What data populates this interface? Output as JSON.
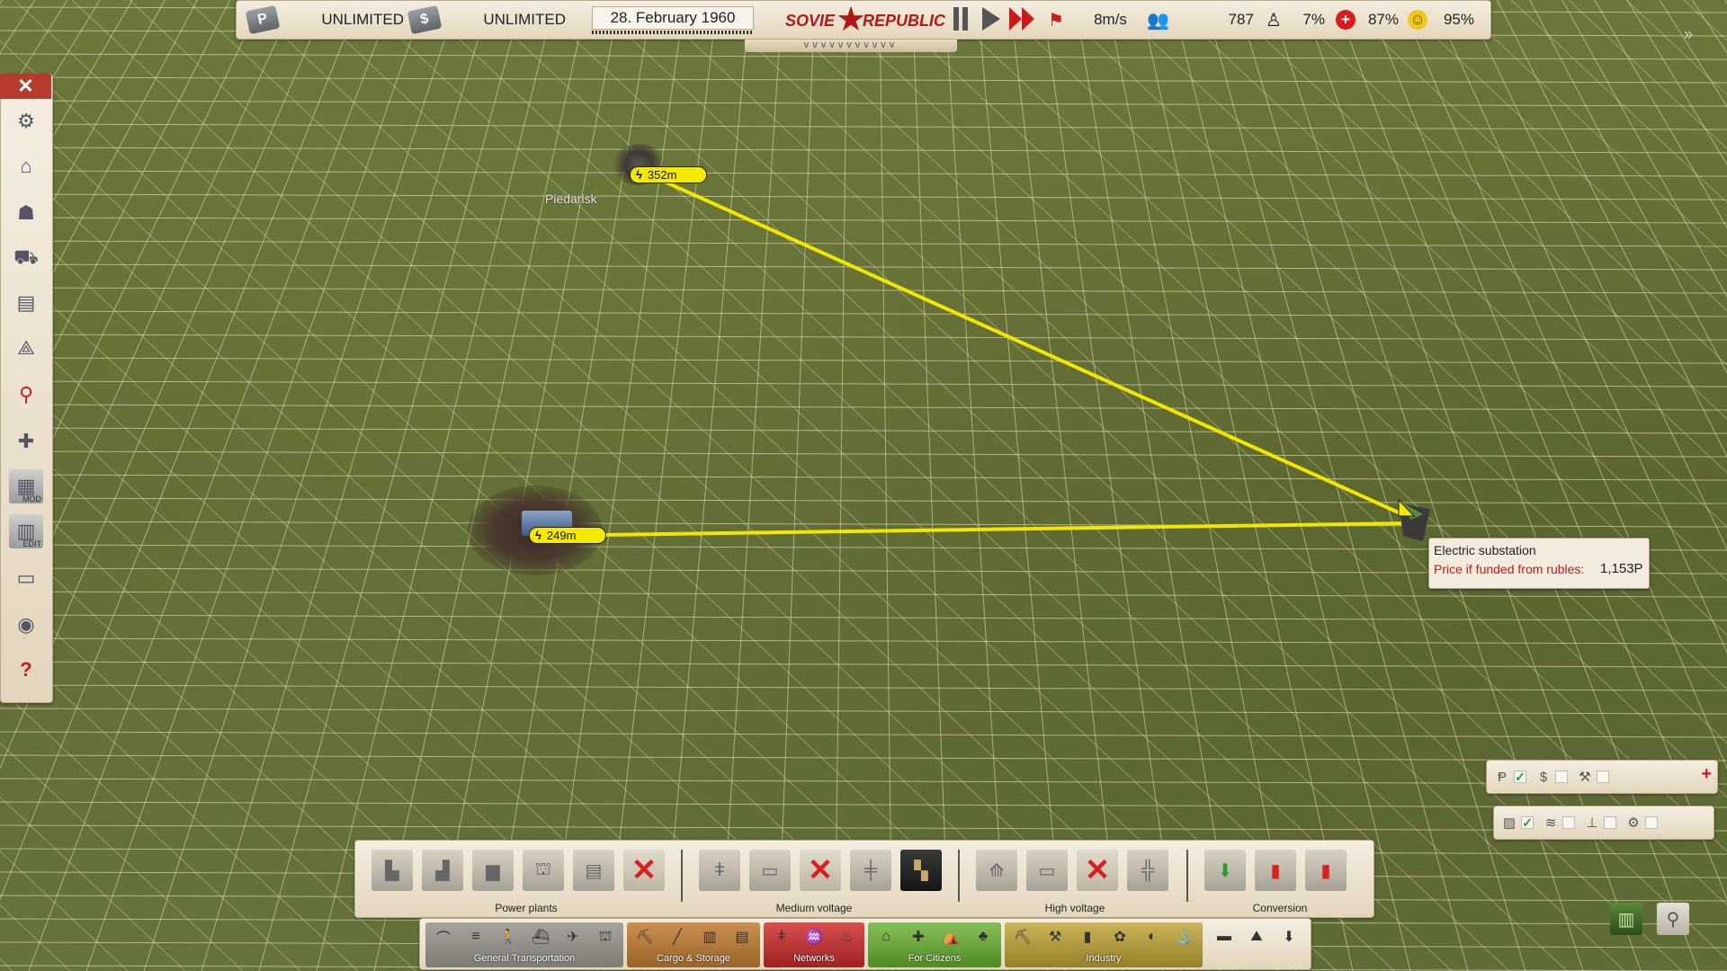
{
  "topbar": {
    "rubles_icon": "P",
    "rubles_value": "UNLIMITED",
    "dollars_icon": "$",
    "dollars_value": "UNLIMITED",
    "date": "28. February 1960",
    "logo_left": "SOVIE",
    "logo_right": "REPUBLIC",
    "wind_speed": "8m/s",
    "population": "787",
    "unemployment": "7%",
    "health": "87%",
    "happiness": "95%",
    "chevrons": "vvvvvvvvvvv"
  },
  "sidebar": {
    "close_label": "✕",
    "items": [
      {
        "icon": "gear-icon",
        "glyph": "⚙"
      },
      {
        "icon": "building-icon",
        "glyph": "⌂"
      },
      {
        "icon": "workers-icon",
        "glyph": "☗"
      },
      {
        "icon": "vehicles-icon",
        "glyph": "⛟"
      },
      {
        "icon": "book-icon",
        "glyph": "▤"
      },
      {
        "icon": "network-icon",
        "glyph": "⟁"
      },
      {
        "icon": "map-pin-icon",
        "glyph": "⚲"
      },
      {
        "icon": "add-building-icon",
        "glyph": "✚"
      },
      {
        "icon": "mod-building-icon",
        "glyph": "▦",
        "label": "MOD"
      },
      {
        "icon": "edit-building-icon",
        "glyph": "▥",
        "label": "EDIT"
      },
      {
        "icon": "story-icon",
        "glyph": "▭"
      },
      {
        "icon": "camera-icon",
        "glyph": "◉"
      },
      {
        "icon": "help-icon",
        "glyph": "?"
      }
    ]
  },
  "map": {
    "town_name": "Piedarisk",
    "tag_top": "352m",
    "tag_bottom": "249m"
  },
  "tooltip": {
    "title": "Electric substation",
    "price_label": "Price if funded from rubles:",
    "price_value": "1,153P"
  },
  "build_panel": {
    "groups": [
      "Power plants",
      "Medium voltage",
      "High voltage",
      "Conversion"
    ]
  },
  "category_bar": {
    "groups": [
      {
        "label": "General Transportation",
        "color": "#8c8a85"
      },
      {
        "label": "Cargo & Storage",
        "color": "#b27a3a"
      },
      {
        "label": "Networks",
        "color": "#c23a3a"
      },
      {
        "label": "For Citizens",
        "color": "#6aa23a"
      },
      {
        "label": "Industry",
        "color": "#b39a3a"
      }
    ]
  },
  "colors": {
    "powerline": "#f2e600",
    "accent_red": "#c01a1a",
    "panel_bg": "#efe6d4",
    "grid_line": "#f6f0c8"
  }
}
